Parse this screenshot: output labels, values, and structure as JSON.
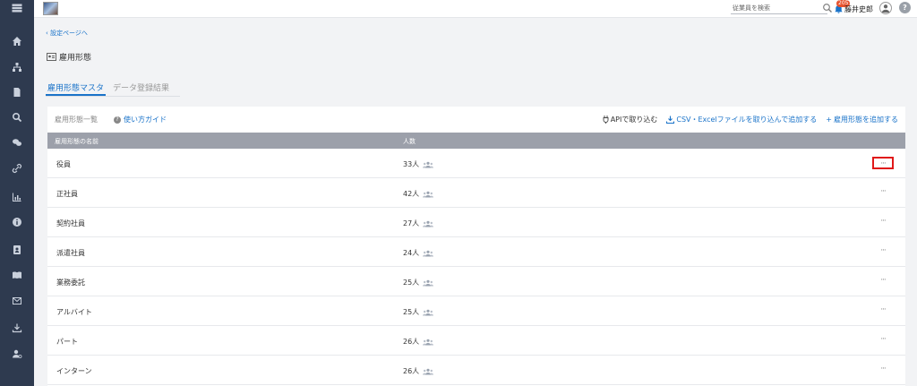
{
  "header": {
    "search_placeholder": "従業員を検索",
    "notification_count": "205",
    "username": "藤井史郎",
    "help": "?"
  },
  "sidebar": {
    "items": [
      "menu-icon",
      "home-icon",
      "org-chart-icon",
      "document-icon",
      "search-icon",
      "chat-icon",
      "link-icon",
      "chart-icon",
      "info-icon",
      "contact-book-icon",
      "book-icon",
      "mail-icon",
      "download-icon",
      "user-settings-icon"
    ]
  },
  "breadcrumb": {
    "back": "設定ページへ"
  },
  "page": {
    "title": "雇用形態"
  },
  "tabs": [
    {
      "label": "雇用形態マスタ",
      "active": true
    },
    {
      "label": "データ登録結果",
      "active": false
    }
  ],
  "list": {
    "title": "雇用形態一覧",
    "guide": "使い方ガイド",
    "actions": {
      "api": "APIで取り込む",
      "csv": "CSV・Excelファイルを取り込んで追加する",
      "add": "雇用形態を追加する"
    },
    "columns": {
      "name": "雇用形態の名前",
      "count": "人数"
    },
    "rows": [
      {
        "name": "役員",
        "count": "33人"
      },
      {
        "name": "正社員",
        "count": "42人"
      },
      {
        "name": "契約社員",
        "count": "27人"
      },
      {
        "name": "派遣社員",
        "count": "24人"
      },
      {
        "name": "業務委託",
        "count": "25人"
      },
      {
        "name": "アルバイト",
        "count": "25人"
      },
      {
        "name": "パート",
        "count": "26人"
      },
      {
        "name": "インターン",
        "count": "26人"
      }
    ],
    "more_label": "···"
  },
  "colors": {
    "sidebar": "#2e3a4f",
    "accent": "#1a73c9",
    "highlight": "#e01919",
    "table_header": "#9ca0aa"
  }
}
